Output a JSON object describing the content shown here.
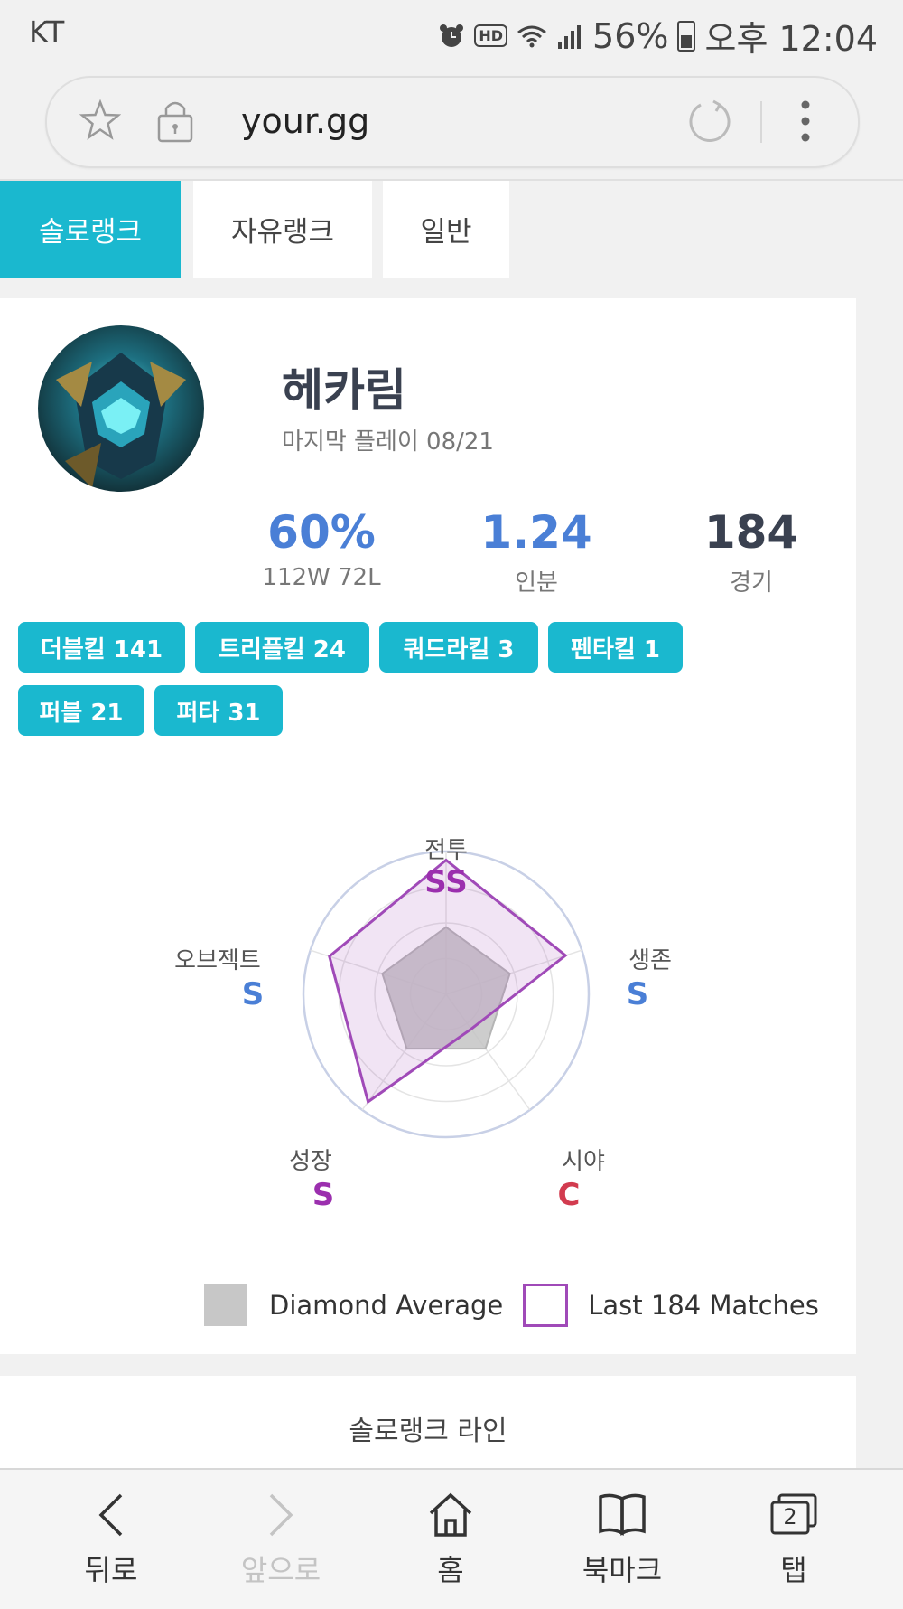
{
  "status": {
    "carrier": "KT",
    "battery": "56%",
    "time": "오후 12:04"
  },
  "browser": {
    "url": "your.gg"
  },
  "tabs": [
    {
      "label": "솔로랭크",
      "active": true
    },
    {
      "label": "자유랭크",
      "active": false
    },
    {
      "label": "일반",
      "active": false
    }
  ],
  "champion": {
    "name": "헤카림",
    "last_played": "마지막 플레이 08/21"
  },
  "stats": {
    "winrate": "60%",
    "record": "112W 72L",
    "kda": "1.24",
    "kda_label": "인분",
    "games": "184",
    "games_label": "경기"
  },
  "badges": [
    "더블킬 141",
    "트리플킬 24",
    "쿼드라킬 3",
    "펜타킬 1",
    "퍼블 21",
    "퍼타 31"
  ],
  "radar": {
    "axes": [
      {
        "label": "전투",
        "grade": "SS",
        "grade_color": "#9b2fae"
      },
      {
        "label": "생존",
        "grade": "S",
        "grade_color": "#4a7fd6"
      },
      {
        "label": "시야",
        "grade": "C",
        "grade_color": "#d23b4f"
      },
      {
        "label": "성장",
        "grade": "S",
        "grade_color": "#9b2fae"
      },
      {
        "label": "오브젝트",
        "grade": "S",
        "grade_color": "#4a7fd6"
      }
    ],
    "average_values": [
      0.47,
      0.47,
      0.47,
      0.47,
      0.47
    ],
    "player_values": [
      0.94,
      0.88,
      0.3,
      0.93,
      0.86
    ],
    "legend_average": "Diamond Average",
    "legend_player": "Last 184 Matches"
  },
  "section": {
    "title": "솔로랭크 라인"
  },
  "bottom_nav": [
    {
      "label": "뒤로",
      "icon": "back-icon",
      "enabled": true
    },
    {
      "label": "앞으로",
      "icon": "forward-icon",
      "enabled": false
    },
    {
      "label": "홈",
      "icon": "home-icon",
      "enabled": true
    },
    {
      "label": "북마크",
      "icon": "bookmark-icon",
      "enabled": true
    },
    {
      "label": "탭",
      "icon": "tabs-icon",
      "enabled": true,
      "count": "2"
    }
  ]
}
